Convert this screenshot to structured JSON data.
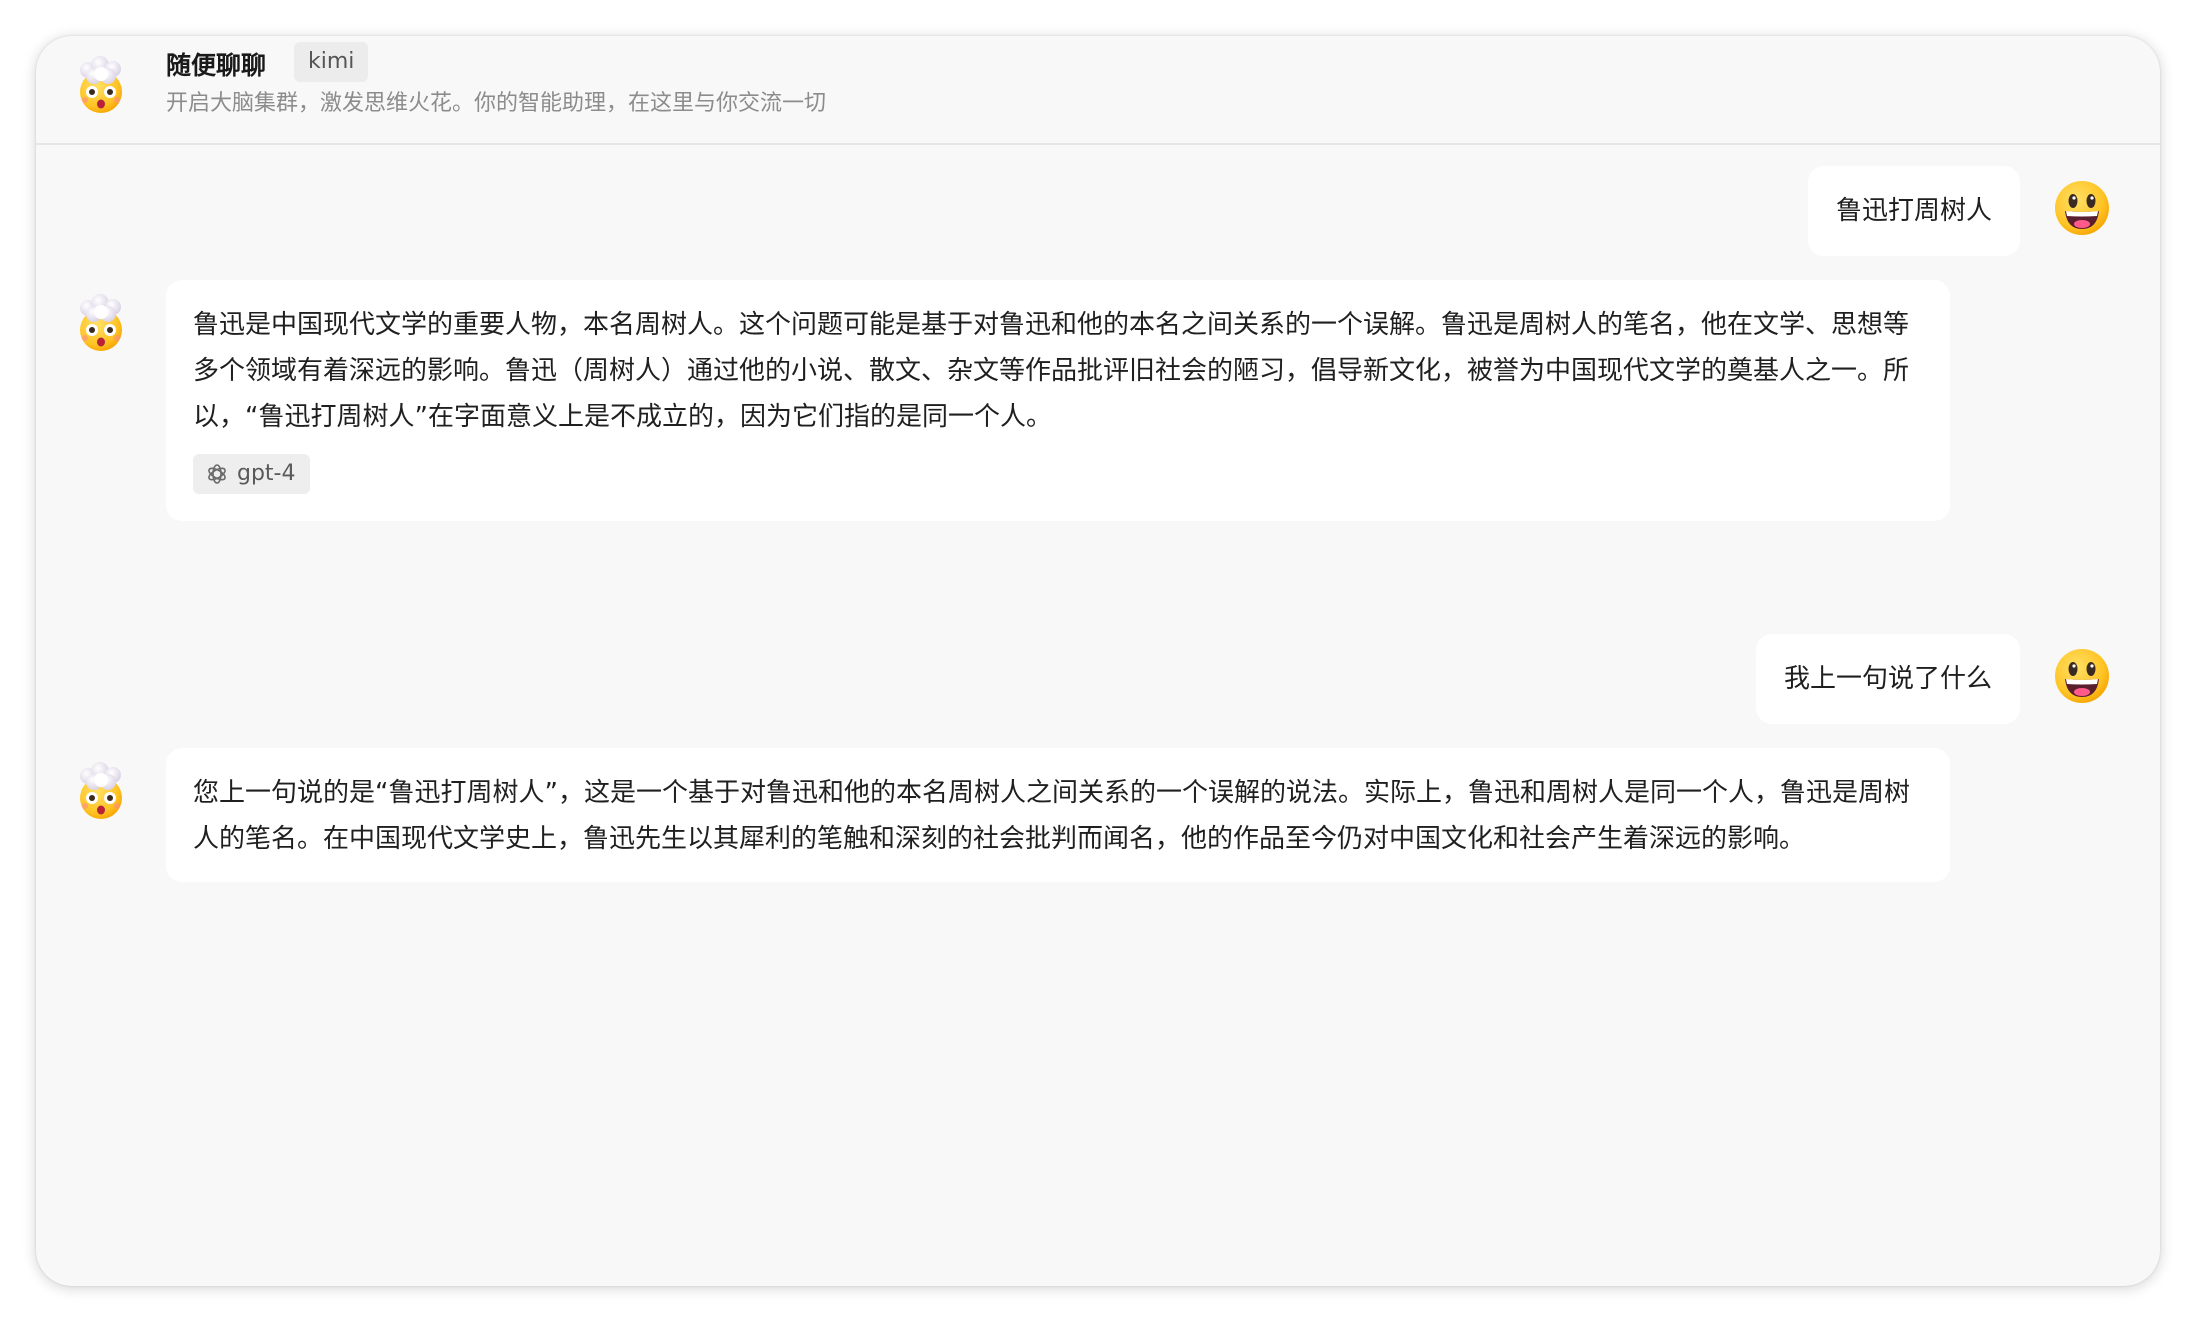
{
  "header": {
    "title": "随便聊聊",
    "tag": "kimi",
    "subtitle": "开启大脑集群，激发思维火花。你的智能助理，在这里与你交流一切",
    "avatar_icon": "exploding-head-emoji"
  },
  "messages": [
    {
      "role": "user",
      "text": "鲁迅打周树人",
      "avatar_icon": "grinning-face-emoji"
    },
    {
      "role": "assistant",
      "text": "鲁迅是中国现代文学的重要人物，本名周树人。这个问题可能是基于对鲁迅和他的本名之间关系的一个误解。鲁迅是周树人的笔名，他在文学、思想等多个领域有着深远的影响。鲁迅（周树人）通过他的小说、散文、杂文等作品批评旧社会的陋习，倡导新文化，被誉为中国现代文学的奠基人之一。所以，“鲁迅打周树人”在字面意义上是不成立的，因为它们指的是同一个人。",
      "model": "gpt-4",
      "model_icon": "openai-logo-icon",
      "avatar_icon": "exploding-head-emoji"
    },
    {
      "role": "user",
      "text": "我上一句说了什么",
      "avatar_icon": "grinning-face-emoji"
    },
    {
      "role": "assistant",
      "text": "您上一句说的是“鲁迅打周树人”，这是一个基于对鲁迅和他的本名周树人之间关系的一个误解的说法。实际上，鲁迅和周树人是同一个人，鲁迅是周树人的笔名。在中国现代文学史上，鲁迅先生以其犀利的笔触和深刻的社会批判而闻名，他的作品至今仍对中国文化和社会产生着深远的影响。",
      "avatar_icon": "exploding-head-emoji"
    }
  ],
  "colors": {
    "background": "#f8f8f8",
    "bubble": "#ffffff",
    "text": "#1f1f1f",
    "subtitle": "#8c8c8c"
  }
}
